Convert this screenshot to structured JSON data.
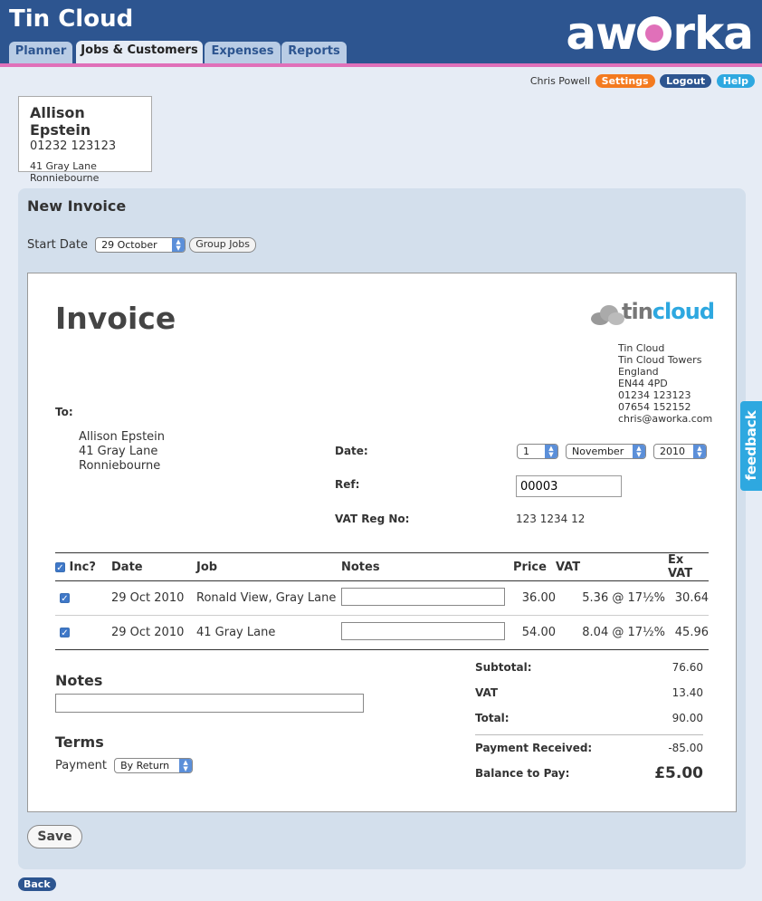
{
  "app": {
    "title": "Tin Cloud",
    "brand": "aworka"
  },
  "tabs": [
    {
      "label": "Planner"
    },
    {
      "label": "Jobs & Customers"
    },
    {
      "label": "Expenses"
    },
    {
      "label": "Reports"
    }
  ],
  "user": {
    "name": "Chris Powell",
    "settings": "Settings",
    "logout": "Logout",
    "help": "Help"
  },
  "customer": {
    "name": "Allison Epstein",
    "phone": "01232 123123",
    "address1": "41 Gray Lane",
    "address2": "Ronniebourne"
  },
  "panel": {
    "title": "New Invoice",
    "start_date_label": "Start Date",
    "start_date": "29 October",
    "group_jobs": "Group Jobs"
  },
  "invoice": {
    "title": "Invoice",
    "logo_tin": "tin",
    "logo_cloud": "cloud",
    "company": [
      "Tin Cloud",
      "Tin Cloud Towers",
      "England",
      "EN44 4PD",
      "01234 123123",
      "07654 152152",
      "chris@aworka.com"
    ],
    "to_label": "To:",
    "to": [
      "Allison Epstein",
      "41 Gray Lane",
      "Ronniebourne"
    ],
    "date_label": "Date:",
    "date_day": "1",
    "date_month": "November",
    "date_year": "2010",
    "ref_label": "Ref:",
    "ref": "00003",
    "vat_label": "VAT Reg No:",
    "vat_no": "123 1234 12",
    "columns": {
      "inc": "Inc?",
      "date": "Date",
      "job": "Job",
      "notes": "Notes",
      "price": "Price",
      "vat": "VAT",
      "exvat": "Ex VAT"
    },
    "items": [
      {
        "date": "29 Oct 2010",
        "job": "Ronald View, Gray Lane",
        "price": "36.00",
        "vat": "5.36 @ 17½%",
        "exvat": "30.64"
      },
      {
        "date": "29 Oct 2010",
        "job": "41 Gray Lane",
        "price": "54.00",
        "vat": "8.04 @ 17½%",
        "exvat": "45.96"
      }
    ],
    "notes_heading": "Notes",
    "terms_heading": "Terms",
    "payment_label": "Payment",
    "payment_value": "By Return",
    "totals": {
      "subtotal_label": "Subtotal:",
      "subtotal": "76.60",
      "vat_label": "VAT",
      "vat": "13.40",
      "total_label": "Total:",
      "total": "90.00",
      "received_label": "Payment Received:",
      "received": "-85.00",
      "balance_label": "Balance to Pay:",
      "balance": "£5.00"
    }
  },
  "save": "Save",
  "back": "Back",
  "feedback": "feedback",
  "colors": {
    "header": "#2d5590",
    "accent_pink": "#e070b9",
    "orange": "#f47a1f",
    "blue": "#2ea8e0"
  }
}
